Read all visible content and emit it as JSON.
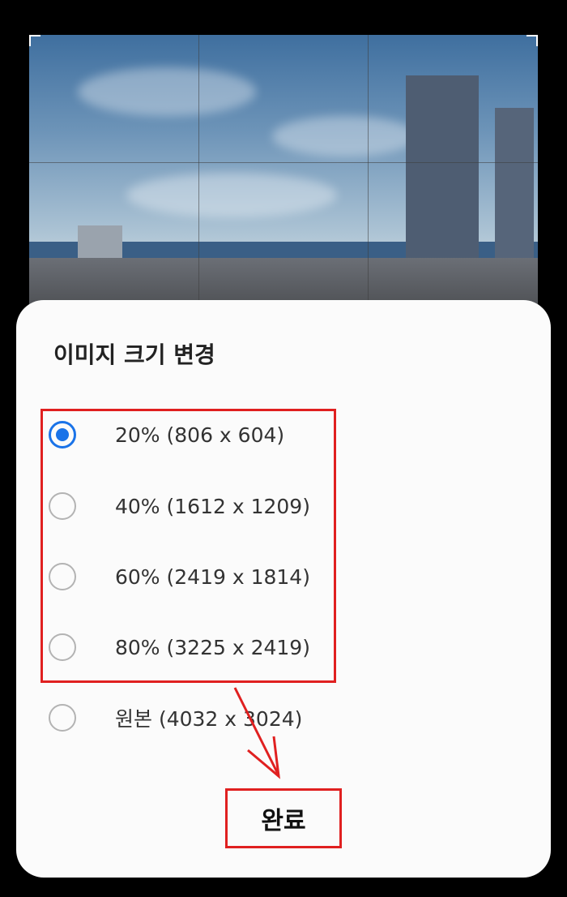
{
  "dialog": {
    "title": "이미지 크기 변경",
    "options": [
      {
        "label": "20% (806 x 604)",
        "selected": true
      },
      {
        "label": "40% (1612 x 1209)",
        "selected": false
      },
      {
        "label": "60% (2419 x 1814)",
        "selected": false
      },
      {
        "label": "80% (3225 x 2419)",
        "selected": false
      },
      {
        "label": "원본 (4032 x 3024)",
        "selected": false
      }
    ],
    "done_label": "완료"
  },
  "colors": {
    "accent": "#1a73e8",
    "annotation": "#e02020"
  }
}
